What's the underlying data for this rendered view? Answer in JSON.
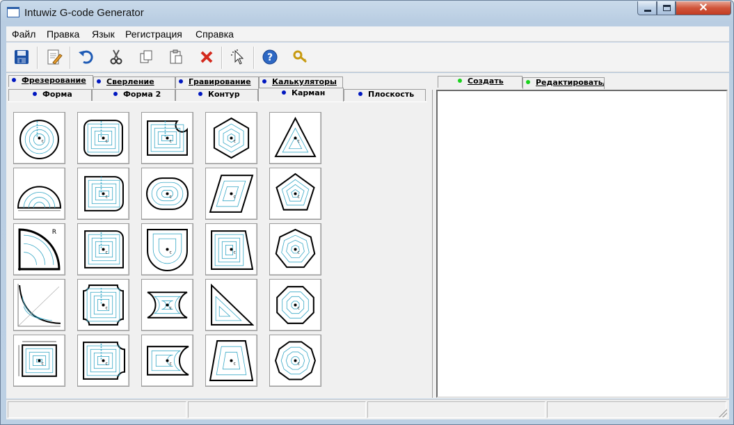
{
  "window": {
    "title": "Intuwiz G-code Generator",
    "close_glyph": "✕"
  },
  "menu": {
    "file": "Файл",
    "edit": "Правка",
    "language": "Язык",
    "registration": "Регистрация",
    "help": "Справка"
  },
  "toolbar": {
    "icons": [
      "save-icon",
      "edit-document-icon",
      "undo-icon",
      "cut-icon",
      "copy-icon",
      "paste-icon",
      "delete-icon",
      "pointer-icon",
      "help-icon",
      "key-icon"
    ]
  },
  "tabs": {
    "top": [
      "Фрезерование",
      "Сверление",
      "Гравирование",
      "Калькуляторы"
    ],
    "sub": [
      "Форма",
      "Форма 2",
      "Контур",
      "Карман",
      "Плоскость"
    ],
    "active_sub": "Карман",
    "right": [
      "Создать",
      "Редактировать/Удалить"
    ],
    "right_visible": [
      "Создать",
      "Редактировать/У"
    ]
  },
  "shapes": [
    [
      "pocket-circle",
      "pocket-rounded-rect",
      "pocket-rect-cutcorner",
      "pocket-hexagon",
      "pocket-triangle"
    ],
    [
      "pocket-half-circle",
      "pocket-rect-round-right",
      "pocket-obround",
      "pocket-parallelogram",
      "pocket-pentagon"
    ],
    [
      "pocket-quarter-circle",
      "pocket-rect-one-round",
      "pocket-d-shape",
      "pocket-trapezoid-right",
      "pocket-heptagon"
    ],
    [
      "pocket-fillet-curve",
      "pocket-concave-corners",
      "pocket-concave-sides",
      "pocket-right-triangle",
      "pocket-octagon"
    ],
    [
      "pocket-rect-dimensions",
      "pocket-rect-concave-right",
      "pocket-rect-concave-end",
      "pocket-trapezoid",
      "pocket-decagon"
    ]
  ],
  "colors": {
    "toolpath": "#3aa9c7",
    "tab_dot": "#0017c0",
    "right_tab_dot": "#19d31c"
  }
}
